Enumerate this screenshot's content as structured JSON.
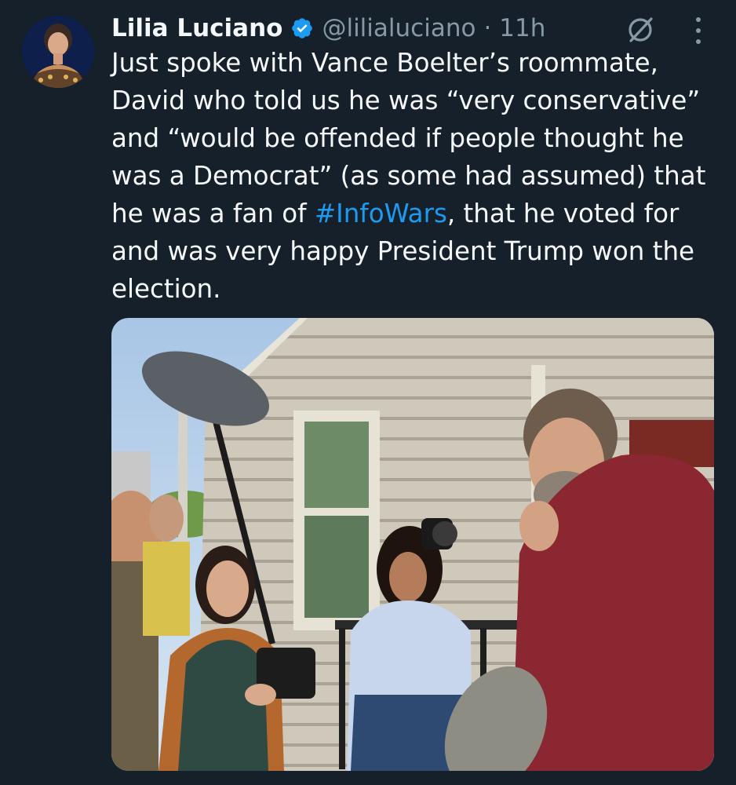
{
  "tweet": {
    "author_name": "Lilia Luciano",
    "handle": "@lilialuciano",
    "separator": "·",
    "time": "11h",
    "text_before": "Just spoke with Vance Boelter’s roommate, David who told us he was “very conservative” and “would be offended if people thought he was a Democrat” (as some had assumed) that he was a fan of ",
    "hashtag": "#InfoWars",
    "text_after": ", that he voted for and was very happy President Trump won the election.",
    "icons": {
      "verified": "verified-badge-icon",
      "grok": "grok-icon",
      "more": "more-options-icon"
    },
    "colors": {
      "background": "#15202b",
      "hashtag": "#1d9bf0",
      "verified": "#1d9bf0",
      "secondary_text": "#8899a6"
    }
  }
}
